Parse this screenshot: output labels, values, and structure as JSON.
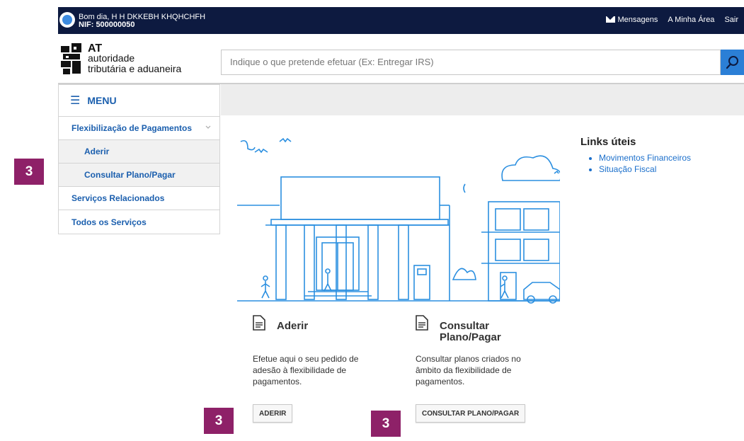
{
  "topbar": {
    "greeting": "Bom dia, H H DKKEBH KHQHCHFH",
    "nif": "NIF: 500000050",
    "nav": {
      "messages": "Mensagens",
      "my_area": "A Minha Área",
      "logout": "Sair"
    }
  },
  "logo": {
    "line1": "AT",
    "line2": "autoridade",
    "line3": "tributária e aduaneira"
  },
  "search": {
    "placeholder": "Indique o que pretende efetuar (Ex: Entregar IRS)"
  },
  "menu": {
    "title": "MENU",
    "items": [
      {
        "label": "Flexibilização de Pagamentos"
      },
      {
        "label": "Aderir"
      },
      {
        "label": "Consultar Plano/Pagar"
      },
      {
        "label": "Serviços Relacionados"
      },
      {
        "label": "Todos os Serviços"
      }
    ]
  },
  "cards": [
    {
      "title": "Aderir",
      "desc": "Efetue aqui o seu pedido de adesão à flexibilidade de pagamentos.",
      "button": "ADERIR"
    },
    {
      "title": "Consultar Plano/Pagar",
      "desc": "Consultar planos criados no âmbito da flexibilidade de pagamentos.",
      "button": "CONSULTAR PLANO/PAGAR"
    }
  ],
  "links": {
    "title": "Links úteis",
    "items": [
      "Movimentos Financeiros",
      "Situação Fiscal"
    ]
  },
  "badges": [
    "3",
    "3",
    "3"
  ],
  "colors": {
    "topbar": "#0d1a40",
    "link": "#1b6fcb",
    "search_button": "#2b7fd6",
    "badge": "#8e2168"
  }
}
